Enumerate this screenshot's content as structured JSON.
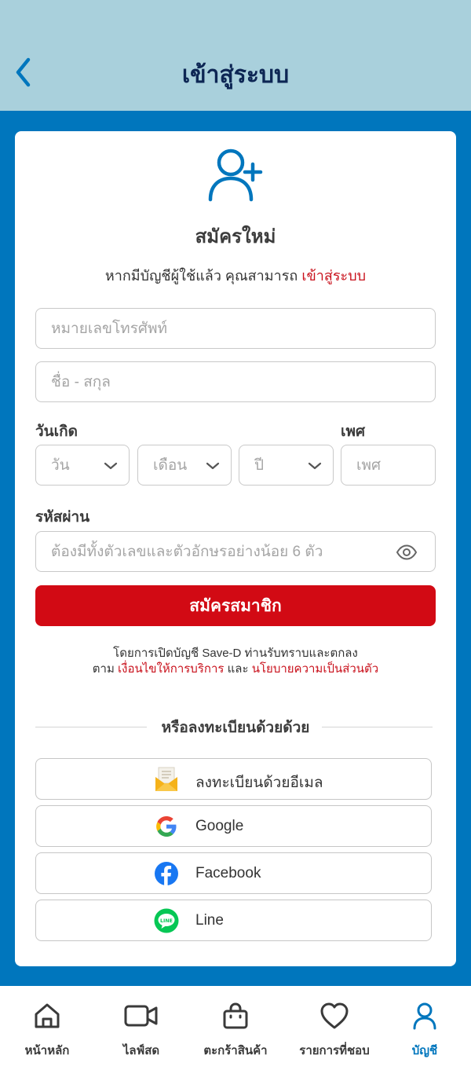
{
  "header": {
    "title": "เข้าสู่ระบบ",
    "back_icon": "chevron-left-icon"
  },
  "card": {
    "icon": "user-plus-icon",
    "title": "สมัครใหม่",
    "login_prompt": "หากมีบัญชีผู้ใช้แล้ว คุณสามารถ",
    "login_link": "เข้าสู่ระบบ"
  },
  "form": {
    "phone_placeholder": "หมายเลขโทรศัพท์",
    "name_placeholder": "ชื่อ - สกุล",
    "birthdate_label": "วันเกิด",
    "day_placeholder": "วัน",
    "month_placeholder": "เดือน",
    "year_placeholder": "ปี",
    "gender_label": "เพศ",
    "gender_placeholder": "เพศ",
    "password_label": "รหัสผ่าน",
    "password_placeholder": "ต้องมีทั้งตัวเลขและตัวอักษรอย่างน้อย 6 ตัว",
    "submit_label": "สมัครสมาชิก"
  },
  "terms": {
    "line1": "โดยการเปิดบัญชี Save-D ท่านรับทราบและตกลง",
    "prefix": "ตาม",
    "terms_link": "เงื่อนไขให้การบริการ",
    "and": "และ",
    "privacy_link": "นโยบายความเป็นส่วนตัว"
  },
  "social": {
    "divider": "หรือลงทะเบียนด้วยด้วย",
    "buttons": [
      {
        "label": "ลงทะเบียนด้วยอีเมล",
        "icon": "email-envelope-icon"
      },
      {
        "label": "Google",
        "icon": "google-icon"
      },
      {
        "label": "Facebook",
        "icon": "facebook-icon"
      },
      {
        "label": "Line",
        "icon": "line-icon"
      }
    ]
  },
  "nav": {
    "items": [
      {
        "label": "หน้าหลัก",
        "icon": "home-icon",
        "active": false
      },
      {
        "label": "ไลฟ์สด",
        "icon": "video-icon",
        "active": false
      },
      {
        "label": "ตะกร้าสินค้า",
        "icon": "shopping-bag-icon",
        "active": false
      },
      {
        "label": "รายการที่ชอบ",
        "icon": "heart-icon",
        "active": false
      },
      {
        "label": "บัญชี",
        "icon": "user-icon",
        "active": true
      }
    ]
  },
  "colors": {
    "header_bg": "#a9d0dc",
    "brand_blue": "#0076bd",
    "primary_red": "#d20a14",
    "link_red": "#c9111c",
    "title_navy": "#0d2654"
  }
}
